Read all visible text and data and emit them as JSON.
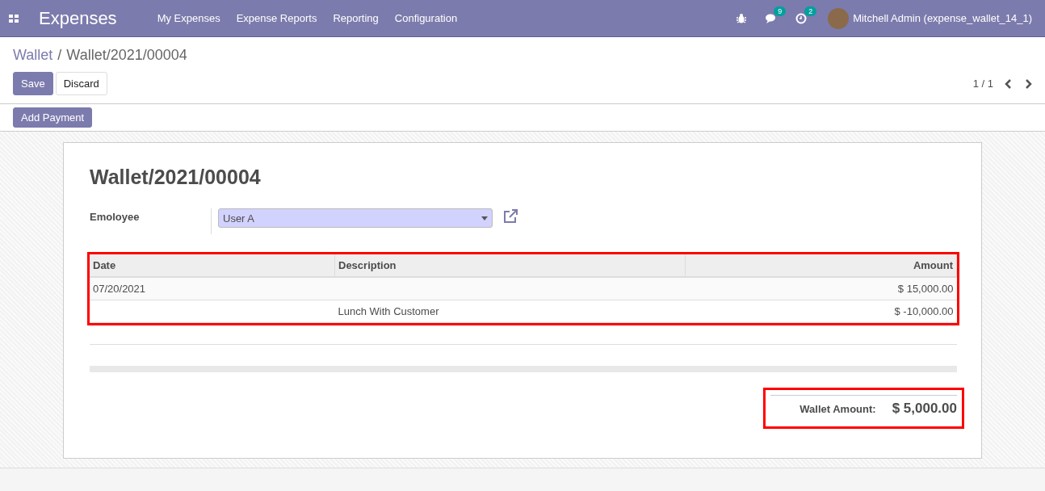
{
  "navbar": {
    "app_name": "Expenses",
    "menu": [
      "My Expenses",
      "Expense Reports",
      "Reporting",
      "Configuration"
    ],
    "messages_badge": "9",
    "activities_badge": "2",
    "user": "Mitchell Admin (expense_wallet_14_1)"
  },
  "breadcrumb": {
    "parent": "Wallet",
    "separator": "/",
    "current": "Wallet/2021/00004"
  },
  "buttons": {
    "save": "Save",
    "discard": "Discard"
  },
  "pager": "1 / 1",
  "header_buttons": [
    "Add Payment"
  ],
  "sheet": {
    "title": "Wallet/2021/00004",
    "field": {
      "label": "Emoloyee",
      "value": "User A"
    },
    "table": {
      "highlight": true,
      "columns": [
        "Date",
        "Description",
        "Amount"
      ],
      "rows": [
        [
          "07/20/2021",
          "",
          "$ 15,000.00"
        ],
        [
          "",
          "Lunch With Customer",
          "$ -10,000.00"
        ]
      ]
    },
    "total": {
      "highlight": true,
      "label": "Wallet Amount:",
      "value": "$ 5,000.00"
    }
  }
}
